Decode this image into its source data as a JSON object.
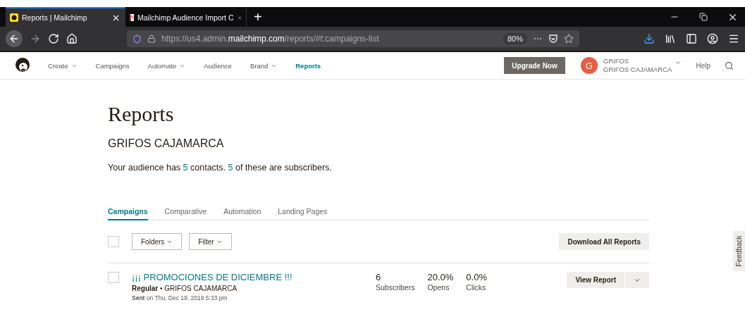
{
  "browser": {
    "tabs": [
      {
        "title": "Reports | Mailchimp",
        "selected": true,
        "kind": "mailchimp"
      },
      {
        "title": "Mailchimp Audience Import C",
        "selected": false,
        "kind": "gmail"
      }
    ],
    "new_tab": "+",
    "url": {
      "host_pre": "https://us4.admin.",
      "host": "mailchimp.com",
      "path": "/reports/#t:campaigns-list"
    },
    "zoom": "80%"
  },
  "nav": {
    "items": [
      {
        "label": "Create",
        "dropdown": true,
        "selected": false
      },
      {
        "label": "Campaigns",
        "dropdown": false,
        "selected": false
      },
      {
        "label": "Automate",
        "dropdown": true,
        "selected": false
      },
      {
        "label": "Audience",
        "dropdown": false,
        "selected": false
      },
      {
        "label": "Brand",
        "dropdown": true,
        "selected": false
      },
      {
        "label": "Reports",
        "dropdown": false,
        "selected": true
      }
    ],
    "upgrade": "Upgrade Now",
    "avatar": "G",
    "account_line1": "GRIFOS",
    "account_line2": "GRIFOS CAJAMARCA",
    "help": "Help"
  },
  "page": {
    "title": "Reports",
    "audience": "GRIFOS CAJAMARCA",
    "summary": {
      "before": "Your audience has ",
      "contacts": "5",
      "middle": " contacts. ",
      "subscribers": "5",
      "after": " of these are subscribers."
    }
  },
  "tabs": [
    {
      "label": "Campaigns",
      "selected": true
    },
    {
      "label": "Comparative",
      "selected": false
    },
    {
      "label": "Automation",
      "selected": false
    },
    {
      "label": "Landing Pages",
      "selected": false
    }
  ],
  "toolbar": {
    "select_all_checked": false,
    "folders": "Folders",
    "filter": "Filter",
    "download": "Download All Reports"
  },
  "campaigns": [
    {
      "checked": false,
      "name": "¡¡¡ PROMOCIONES DE DICIEMBRE !!!",
      "type": "Regular",
      "audience": "• GRIFOS CAJAMARCA",
      "sent_label": "Sent",
      "sent_on": "on Thu, Dec 19, 2019 5:33 pm",
      "stats": [
        {
          "value": "6",
          "label": "Subscribers"
        },
        {
          "value": "20.0%",
          "label": "Opens"
        },
        {
          "value": "0.0%",
          "label": "Clicks"
        }
      ],
      "action": "View Report"
    }
  ],
  "feedback": "Feedback"
}
